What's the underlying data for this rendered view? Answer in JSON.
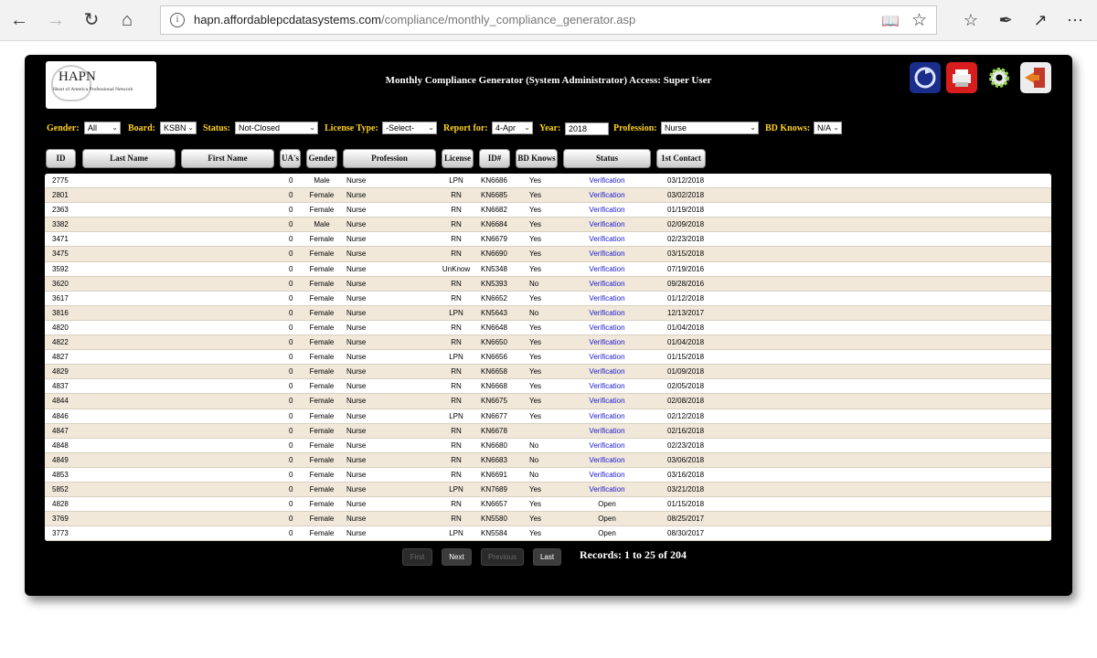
{
  "browser": {
    "url_host": "hapn.affordablepcdatasystems.com",
    "url_path": "/compliance/monthly_compliance_generator.asp"
  },
  "logo": {
    "title": "HAPN",
    "subtitle": "Heart of America Professional Network"
  },
  "page_title": "Monthly Compliance Generator (System Administrator) Access: Super User",
  "filters": {
    "gender_label": "Gender:",
    "gender_value": "All",
    "board_label": "Board:",
    "board_value": "KSBN",
    "status_label": "Status:",
    "status_value": "Not-Closed",
    "license_type_label": "License Type:",
    "license_type_value": "-Select-",
    "report_for_label": "Report for:",
    "report_for_value": "4-Apr",
    "year_label": "Year:",
    "year_value": "2018",
    "profession_label": "Profession:",
    "profession_value": "Nurse",
    "bd_knows_label": "BD Knows:",
    "bd_knows_value": "N/A"
  },
  "columns": [
    "ID",
    "Last Name",
    "First Name",
    "UA's",
    "Gender",
    "Profession",
    "License",
    "ID#",
    "BD Knows",
    "Status",
    "1st Contact"
  ],
  "rows": [
    {
      "id": "2775",
      "ua": "0",
      "gender": "Male",
      "profession": "Nurse",
      "license": "LPN",
      "idnum": "KN6686",
      "bd": "Yes",
      "status": "Verification",
      "contact": "03/12/2018"
    },
    {
      "id": "2801",
      "ua": "0",
      "gender": "Female",
      "profession": "Nurse",
      "license": "RN",
      "idnum": "KN6685",
      "bd": "Yes",
      "status": "Verification",
      "contact": "03/02/2018"
    },
    {
      "id": "2363",
      "ua": "0",
      "gender": "Female",
      "profession": "Nurse",
      "license": "RN",
      "idnum": "KN6682",
      "bd": "Yes",
      "status": "Verification",
      "contact": "01/19/2018"
    },
    {
      "id": "3382",
      "ua": "0",
      "gender": "Male",
      "profession": "Nurse",
      "license": "RN",
      "idnum": "KN6684",
      "bd": "Yes",
      "status": "Verification",
      "contact": "02/09/2018"
    },
    {
      "id": "3471",
      "ua": "0",
      "gender": "Female",
      "profession": "Nurse",
      "license": "RN",
      "idnum": "KN6679",
      "bd": "Yes",
      "status": "Verification",
      "contact": "02/23/2018"
    },
    {
      "id": "3475",
      "ua": "0",
      "gender": "Female",
      "profession": "Nurse",
      "license": "RN",
      "idnum": "KN6690",
      "bd": "Yes",
      "status": "Verification",
      "contact": "03/15/2018"
    },
    {
      "id": "3592",
      "ua": "0",
      "gender": "Female",
      "profession": "Nurse",
      "license": "UnKnow",
      "idnum": "KN5348",
      "bd": "Yes",
      "status": "Verification",
      "contact": "07/19/2016"
    },
    {
      "id": "3620",
      "ua": "0",
      "gender": "Female",
      "profession": "Nurse",
      "license": "RN",
      "idnum": "KN5393",
      "bd": "No",
      "status": "Verification",
      "contact": "09/28/2016"
    },
    {
      "id": "3617",
      "ua": "0",
      "gender": "Female",
      "profession": "Nurse",
      "license": "RN",
      "idnum": "KN6652",
      "bd": "Yes",
      "status": "Verification",
      "contact": "01/12/2018"
    },
    {
      "id": "3816",
      "ua": "0",
      "gender": "Female",
      "profession": "Nurse",
      "license": "LPN",
      "idnum": "KN5643",
      "bd": "No",
      "status": "Verification",
      "contact": "12/13/2017"
    },
    {
      "id": "4820",
      "ua": "0",
      "gender": "Female",
      "profession": "Nurse",
      "license": "RN",
      "idnum": "KN6648",
      "bd": "Yes",
      "status": "Verification",
      "contact": "01/04/2018"
    },
    {
      "id": "4822",
      "ua": "0",
      "gender": "Female",
      "profession": "Nurse",
      "license": "RN",
      "idnum": "KN6650",
      "bd": "Yes",
      "status": "Verification",
      "contact": "01/04/2018"
    },
    {
      "id": "4827",
      "ua": "0",
      "gender": "Female",
      "profession": "Nurse",
      "license": "LPN",
      "idnum": "KN6656",
      "bd": "Yes",
      "status": "Verification",
      "contact": "01/15/2018"
    },
    {
      "id": "4829",
      "ua": "0",
      "gender": "Female",
      "profession": "Nurse",
      "license": "RN",
      "idnum": "KN6658",
      "bd": "Yes",
      "status": "Verification",
      "contact": "01/09/2018"
    },
    {
      "id": "4837",
      "ua": "0",
      "gender": "Female",
      "profession": "Nurse",
      "license": "RN",
      "idnum": "KN6668",
      "bd": "Yes",
      "status": "Verification",
      "contact": "02/05/2018"
    },
    {
      "id": "4844",
      "ua": "0",
      "gender": "Female",
      "profession": "Nurse",
      "license": "RN",
      "idnum": "KN6675",
      "bd": "Yes",
      "status": "Verification",
      "contact": "02/08/2018"
    },
    {
      "id": "4846",
      "ua": "0",
      "gender": "Female",
      "profession": "Nurse",
      "license": "LPN",
      "idnum": "KN6677",
      "bd": "Yes",
      "status": "Verification",
      "contact": "02/12/2018"
    },
    {
      "id": "4847",
      "ua": "0",
      "gender": "Female",
      "profession": "Nurse",
      "license": "RN",
      "idnum": "KN6678",
      "bd": "",
      "status": "Verification",
      "contact": "02/16/2018"
    },
    {
      "id": "4848",
      "ua": "0",
      "gender": "Female",
      "profession": "Nurse",
      "license": "RN",
      "idnum": "KN6680",
      "bd": "No",
      "status": "Verification",
      "contact": "02/23/2018"
    },
    {
      "id": "4849",
      "ua": "0",
      "gender": "Female",
      "profession": "Nurse",
      "license": "RN",
      "idnum": "KN6683",
      "bd": "No",
      "status": "Verification",
      "contact": "03/06/2018"
    },
    {
      "id": "4853",
      "ua": "0",
      "gender": "Female",
      "profession": "Nurse",
      "license": "RN",
      "idnum": "KN6691",
      "bd": "No",
      "status": "Verification",
      "contact": "03/16/2018"
    },
    {
      "id": "5852",
      "ua": "0",
      "gender": "Female",
      "profession": "Nurse",
      "license": "LPN",
      "idnum": "KN7689",
      "bd": "Yes",
      "status": "Verification",
      "contact": "03/21/2018"
    },
    {
      "id": "4828",
      "ua": "0",
      "gender": "Female",
      "profession": "Nurse",
      "license": "RN",
      "idnum": "KN6657",
      "bd": "Yes",
      "status": "Open",
      "contact": "01/15/2018"
    },
    {
      "id": "3769",
      "ua": "0",
      "gender": "Female",
      "profession": "Nurse",
      "license": "RN",
      "idnum": "KN5580",
      "bd": "Yes",
      "status": "Open",
      "contact": "08/25/2017"
    },
    {
      "id": "3773",
      "ua": "0",
      "gender": "Female",
      "profession": "Nurse",
      "license": "LPN",
      "idnum": "KN5584",
      "bd": "Yes",
      "status": "Open",
      "contact": "08/30/2017"
    }
  ],
  "pager": {
    "first": "First",
    "next": "Next",
    "previous": "Previous",
    "last": "Last",
    "records": "Records: 1 to 25 of 204"
  },
  "colors": {
    "filter_label": "#ffd21a",
    "status_link": "#1a1acc",
    "row_alt": "#f1e8da"
  }
}
